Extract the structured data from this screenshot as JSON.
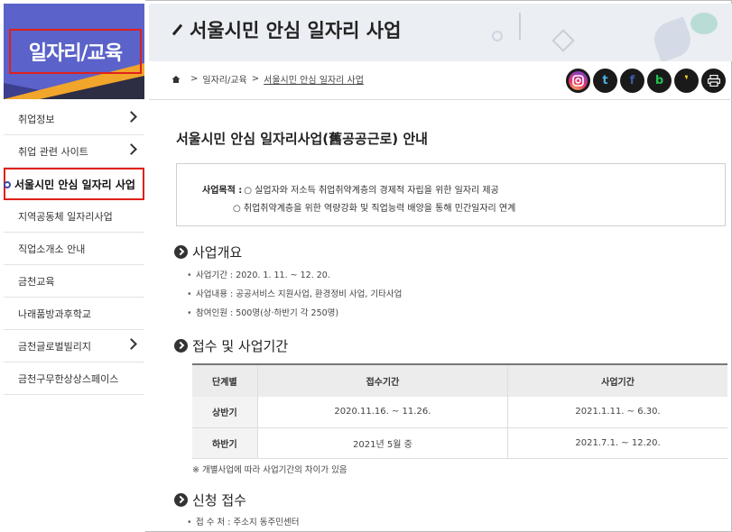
{
  "sidebar": {
    "title": "일자리/교육",
    "items": [
      {
        "label": "취업정보",
        "arrow": true
      },
      {
        "label": "취업 관련 사이트",
        "arrow": true
      },
      {
        "label": "서울시민 안심 일자리 사업",
        "active": true
      },
      {
        "label": "지역공동체 일자리사업"
      },
      {
        "label": "직업소개소 안내"
      },
      {
        "label": "금천교육"
      },
      {
        "label": "나래품방과후학교"
      },
      {
        "label": "금천글로벌빌리지",
        "arrow": true
      },
      {
        "label": "금천구무한상상스페이스"
      }
    ]
  },
  "header": {
    "title": "서울시민 안심 일자리 사업"
  },
  "breadcrumb": {
    "home_icon": "home-icon",
    "items": [
      "일자리/교육",
      "서울시민 안심 일자리 사업"
    ]
  },
  "social": [
    "instagram-icon",
    "twitter-icon",
    "facebook-icon",
    "blog-icon",
    "kakao-icon",
    "print-icon"
  ],
  "social_glyphs": {
    "twitter": "t",
    "facebook": "f",
    "blog": "b",
    "kakao": "❜"
  },
  "content": {
    "heading": "서울시민 안심 일자리사업(舊공공근로) 안내",
    "purpose_label": "사업목적 :",
    "purpose_line1": "○ 실업자와 저소득 취업취약계층의 경제적 자립을 위한 일자리 제공",
    "purpose_line2": "○ 취업취약계층을 위한 역량강화 및 직업능력 배양을 통해 민간일자리 연계",
    "overview_title": "사업개요",
    "overview": [
      "사업기간 : 2020. 1. 11. ~ 12. 20.",
      "사업내용 : 공공서비스 지원사업, 환경정비 사업, 기타사업",
      "참여인원 : 500명(상·하반기 각 250명)"
    ],
    "schedule_title": "접수 및 사업기간",
    "table": {
      "headers": [
        "단계별",
        "접수기간",
        "사업기간"
      ],
      "rows": [
        [
          "상반기",
          "2020.11.16. ~ 11.26.",
          "2021.1.11. ~ 6.30."
        ],
        [
          "하반기",
          "2021년 5월 중",
          "2021.7.1. ~ 12.20."
        ]
      ]
    },
    "note": "※ 개별사업에 따라 사업기간의 차이가 있음",
    "apply_title": "신청 접수",
    "apply_items": [
      "접 수 처 : 주소지 동주민센터"
    ]
  }
}
